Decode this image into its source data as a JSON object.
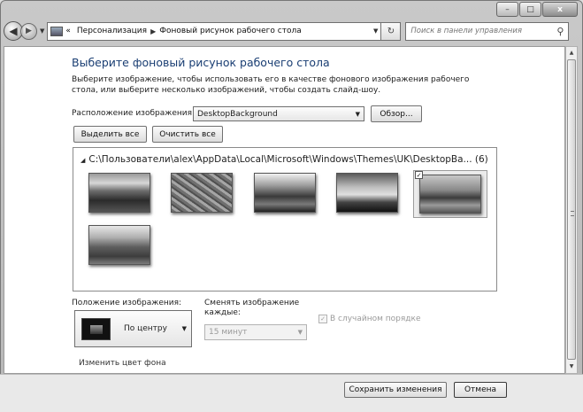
{
  "window": {
    "controls": {
      "minimize": "–",
      "maximize": "□",
      "close": "x"
    }
  },
  "navbar": {
    "back_icon": "back-arrow-icon",
    "forward_icon": "forward-arrow-icon",
    "breadcrumb_prefix": "«",
    "breadcrumbs": [
      "Персонализация",
      "Фоновый рисунок рабочего стола"
    ],
    "refresh_glyph": "↻",
    "search_placeholder": "Поиск в панели управления"
  },
  "main": {
    "title": "Выберите фоновый рисунок рабочего стола",
    "description": "Выберите изображение, чтобы использовать его в качестве фонового изображения рабочего стола, или выберите несколько изображений, чтобы создать слайд-шоу.",
    "location_label": "Расположение изображения:",
    "location_value": "DesktopBackground",
    "browse_label": "Обзор...",
    "select_all_label": "Выделить все",
    "clear_all_label": "Очистить все",
    "gallery": {
      "path": "C:\\Пользователи\\alex\\AppData\\Local\\Microsoft\\Windows\\Themes\\UK\\DesktopBa... (6)",
      "thumbnails": [
        {
          "name": "wallpaper-1",
          "selected": false
        },
        {
          "name": "wallpaper-2",
          "selected": false
        },
        {
          "name": "wallpaper-3",
          "selected": false
        },
        {
          "name": "wallpaper-4",
          "selected": false
        },
        {
          "name": "wallpaper-5",
          "selected": true
        },
        {
          "name": "wallpaper-6",
          "selected": false
        }
      ]
    },
    "position_label": "Положение изображения:",
    "position_value": "По центру",
    "interval_label": "Сменять изображение каждые:",
    "interval_value": "15 минут",
    "shuffle_label": "В случайном порядке",
    "change_color_link": "Изменить цвет фона"
  },
  "footer": {
    "save_label": "Сохранить изменения",
    "cancel_label": "Отмена"
  }
}
